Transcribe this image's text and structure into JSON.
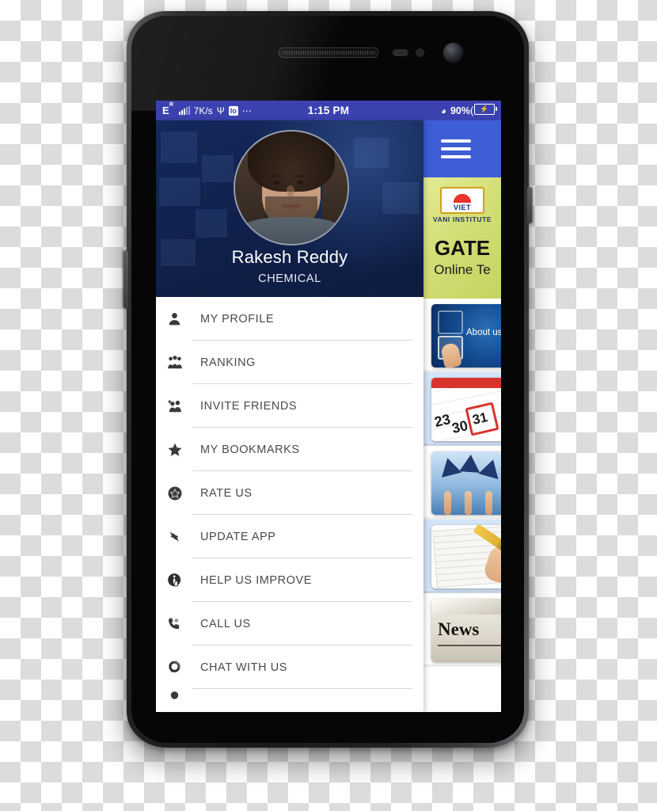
{
  "statusbar": {
    "network_type": "E",
    "network_sup": "R",
    "speed": "7K/s",
    "usb_icon": "usb-icon",
    "chip_label": "Io",
    "more_icon": "more-dots-icon",
    "time": "1:15 PM",
    "wifi_icon": "wifi-icon",
    "battery_percent": "90%",
    "battery_icon": "battery-charging-icon",
    "bg_color": "#3b42b0"
  },
  "drawer": {
    "profile": {
      "avatar_name": "user-avatar",
      "name": "Rakesh Reddy",
      "branch": "CHEMICAL",
      "bg_color": "#102049"
    },
    "items": [
      {
        "icon": "person-icon",
        "glyph": "\u0000",
        "label": "MY PROFILE"
      },
      {
        "icon": "group-people-icon",
        "glyph": "\u0000",
        "label": "RANKING"
      },
      {
        "icon": "add-person-icon",
        "glyph": "\u0000",
        "label": "INVITE FRIENDS"
      },
      {
        "icon": "star-icon",
        "glyph": "★",
        "label": "MY BOOKMARKS"
      },
      {
        "icon": "star-badge-icon",
        "glyph": "\u0000",
        "label": "RATE US"
      },
      {
        "icon": "refresh-update-icon",
        "glyph": "\u0000",
        "label": "UPDATE APP"
      },
      {
        "icon": "info-hand-icon",
        "glyph": "\u0000",
        "label": "HELP US IMPROVE"
      },
      {
        "icon": "phone-call-icon",
        "glyph": "\u0000",
        "label": "CALL US"
      },
      {
        "icon": "chat-bubble-icon",
        "glyph": "\u0000",
        "label": "CHAT WITH US"
      }
    ]
  },
  "content": {
    "topbar": {
      "menu_icon": "hamburger-menu-icon",
      "bg_color": "#3d5ed4"
    },
    "promo": {
      "logo_name": "vani-institute-logo",
      "logo_text": "VIET",
      "institute": "VANI INSTITUTE",
      "title": "GATE",
      "subtitle": "Online Te",
      "bg_color": "#d3de76"
    },
    "cards": [
      {
        "thumb": "about-us-thumbnail",
        "caption": "About us",
        "style": "plain"
      },
      {
        "thumb": "calendar-thumbnail",
        "caption": "",
        "style": "alt"
      },
      {
        "thumb": "graduation-thumbnail",
        "caption": "",
        "style": "plain"
      },
      {
        "thumb": "test-paper-thumbnail",
        "caption": "",
        "style": "alt"
      },
      {
        "thumb": "news-thumbnail",
        "caption": "News",
        "style": "plain"
      }
    ]
  }
}
